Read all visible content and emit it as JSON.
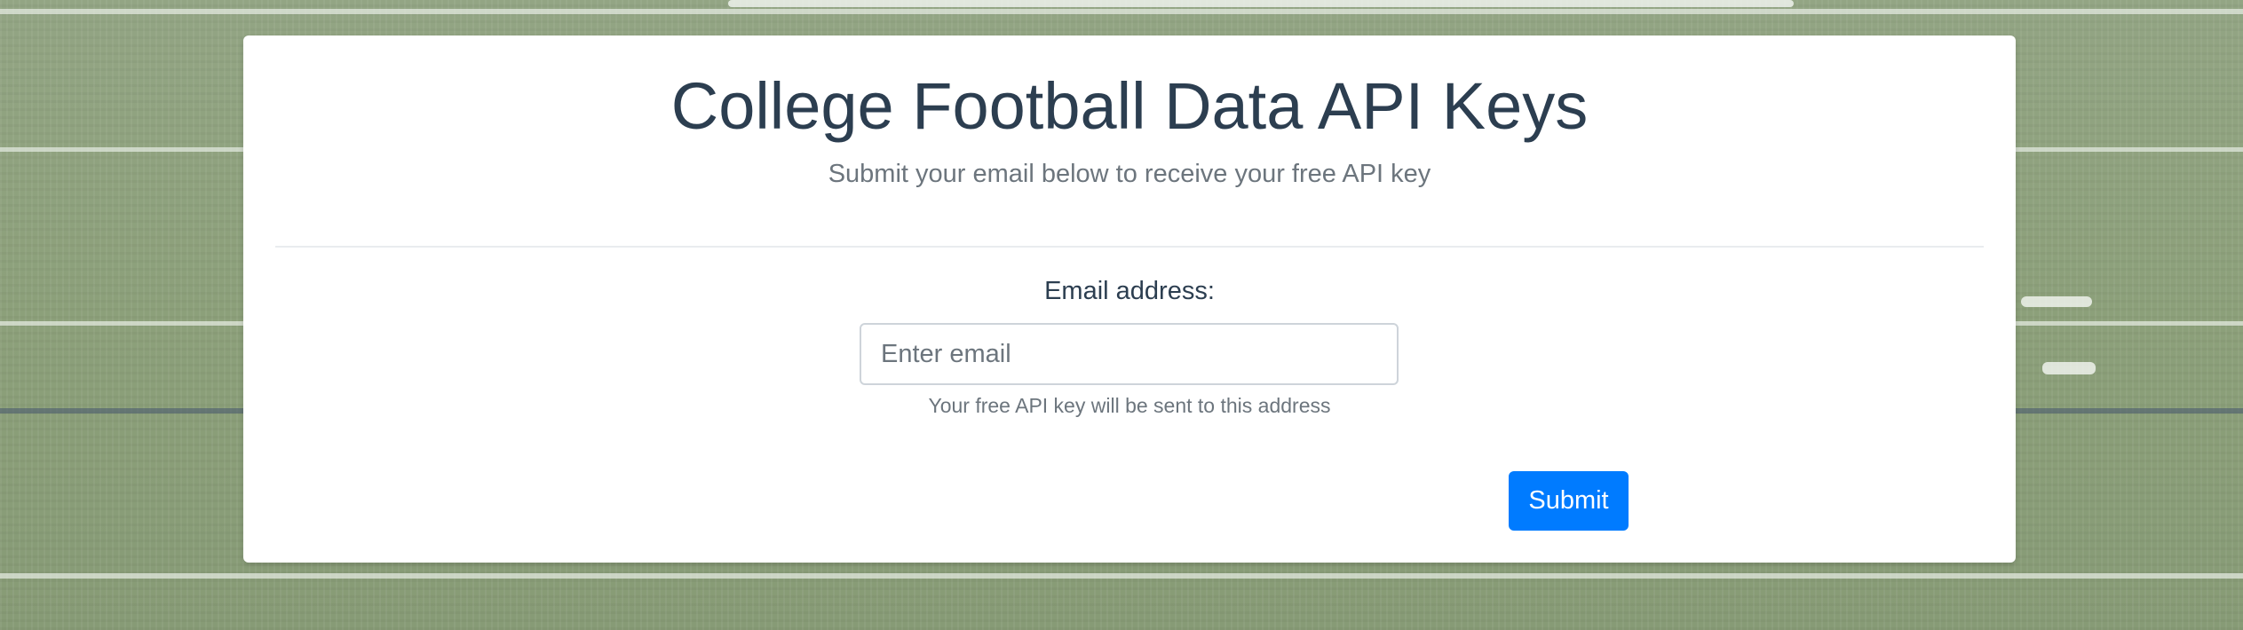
{
  "page": {
    "title": "College Football Data API Keys",
    "subtitle": "Submit your email below to receive your free API key"
  },
  "form": {
    "email_label": "Email address:",
    "email_value": "",
    "email_placeholder": "Enter email",
    "help_text": "Your free API key will be sent to this address",
    "submit_label": "Submit"
  },
  "colors": {
    "accent": "#007bff",
    "title_text": "#2c3e50",
    "muted_text": "#6c757d",
    "background_turf": "#8ea27c"
  }
}
